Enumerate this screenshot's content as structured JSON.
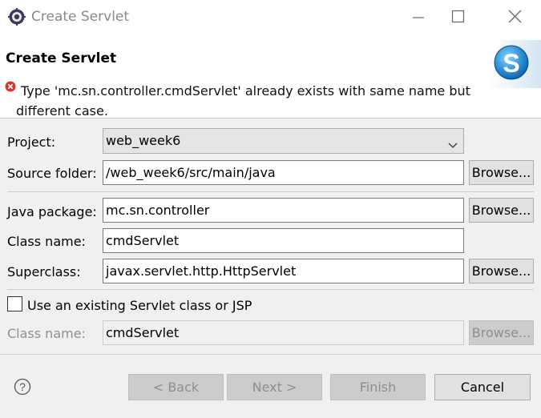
{
  "window": {
    "title": "Create Servlet",
    "icon": "eclipse-gear-icon",
    "controls": [
      "minimize-icon",
      "maximize-icon",
      "close-icon"
    ]
  },
  "banner": {
    "title": "Create Servlet",
    "error_icon": "error-icon",
    "error_line1": "Type 'mc.sn.controller.cmdServlet' already exists with same name but",
    "error_line2": "different case."
  },
  "form": {
    "project_label": "Project:",
    "project_value": "web_week6",
    "source_folder_label": "Source folder:",
    "source_folder_value": "/web_week6/src/main/java",
    "browse_label": "Browse...",
    "java_package_label": "Java package:",
    "java_package_value": "mc.sn.controller",
    "class_name_label": "Class name:",
    "class_name_value": "cmdServlet",
    "superclass_label": "Superclass:",
    "superclass_value": "javax.servlet.http.HttpServlet",
    "existing_checkbox_label": "Use an existing Servlet class or JSP",
    "existing_checked": false,
    "existing_class_label": "Class name:",
    "existing_class_value": "cmdServlet"
  },
  "footer": {
    "help_icon": "help-icon",
    "back": "< Back",
    "next": "Next >",
    "finish": "Finish",
    "cancel": "Cancel"
  },
  "colors": {
    "error_red": "#d9342b",
    "disabled_text": "#8f8f8f",
    "disabled_button": "#cccccc"
  }
}
